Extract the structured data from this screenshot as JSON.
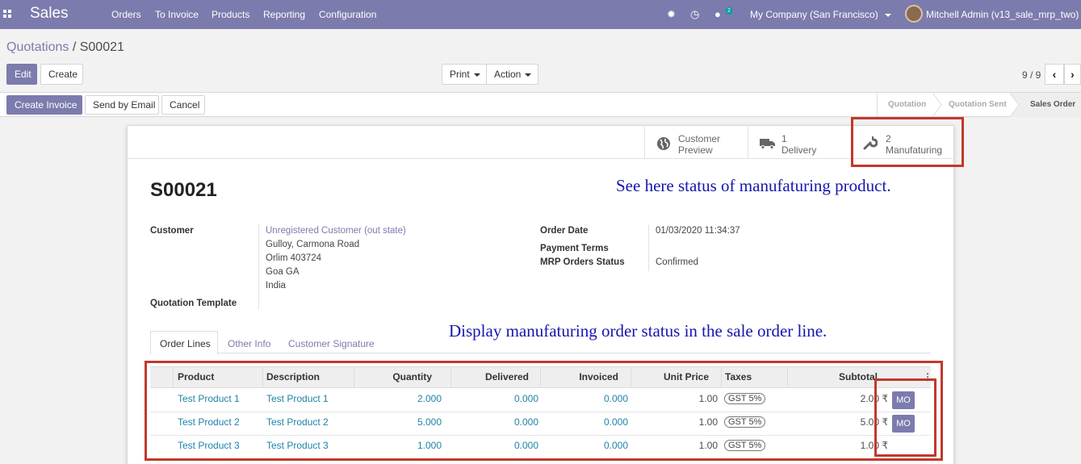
{
  "navbar": {
    "app_name": "Sales",
    "menus": [
      "Orders",
      "To Invoice",
      "Products",
      "Reporting",
      "Configuration"
    ],
    "chat_badge": "2",
    "company": "My Company (San Francisco)",
    "user": "Mitchell Admin (v13_sale_mrp_two)"
  },
  "breadcrumb": {
    "parent": "Quotations",
    "separator": " / ",
    "current": "S00021"
  },
  "toolbar": {
    "edit": "Edit",
    "create": "Create",
    "print": "Print",
    "action": "Action",
    "pager": "9 / 9"
  },
  "statusbar": {
    "create_invoice": "Create Invoice",
    "send_email": "Send by Email",
    "cancel": "Cancel",
    "stages": [
      "Quotation",
      "Quotation Sent",
      "Sales Order"
    ]
  },
  "smart_buttons": {
    "preview_l1": "Customer",
    "preview_l2": "Preview",
    "delivery_count": "1",
    "delivery_label": "Delivery",
    "mfg_count": "2",
    "mfg_label": "Manufaturing"
  },
  "form": {
    "name": "S00021",
    "customer_label": "Customer",
    "customer_name": "Unregistered Customer (out state)",
    "address": [
      "Gulloy, Carmona Road",
      "Orlim 403724",
      "Goa GA",
      "India"
    ],
    "template_label": "Quotation Template",
    "order_date_label": "Order Date",
    "order_date": "01/03/2020 11:34:37",
    "payment_terms_label": "Payment Terms",
    "mrp_status_label": "MRP Orders Status",
    "mrp_status": "Confirmed"
  },
  "annotations": {
    "top": "See here status of manufaturing product.",
    "middle": "Display manufaturing order status in the sale order line."
  },
  "tabs": [
    "Order Lines",
    "Other Info",
    "Customer Signature"
  ],
  "table": {
    "headers": [
      "Product",
      "Description",
      "Quantity",
      "Delivered",
      "Invoiced",
      "Unit Price",
      "Taxes",
      "Subtotal"
    ],
    "rows": [
      {
        "product": "Test Product 1",
        "description": "Test Product 1",
        "quantity": "2.000",
        "delivered": "0.000",
        "invoiced": "0.000",
        "unit_price": "1.00",
        "taxes": "GST 5%",
        "subtotal": "2.00 ₹",
        "mo": "MO"
      },
      {
        "product": "Test Product 2",
        "description": "Test Product 2",
        "quantity": "5.000",
        "delivered": "0.000",
        "invoiced": "0.000",
        "unit_price": "1.00",
        "taxes": "GST 5%",
        "subtotal": "5.00 ₹",
        "mo": "MO"
      },
      {
        "product": "Test Product 3",
        "description": "Test Product 3",
        "quantity": "1.000",
        "delivered": "0.000",
        "invoiced": "0.000",
        "unit_price": "1.00",
        "taxes": "GST 5%",
        "subtotal": "1.00 ₹",
        "mo": ""
      }
    ]
  },
  "colors": {
    "brand": "#7c7bad",
    "highlight": "#c0392b",
    "annotation": "#1515b0",
    "link": "#1f83a8"
  }
}
